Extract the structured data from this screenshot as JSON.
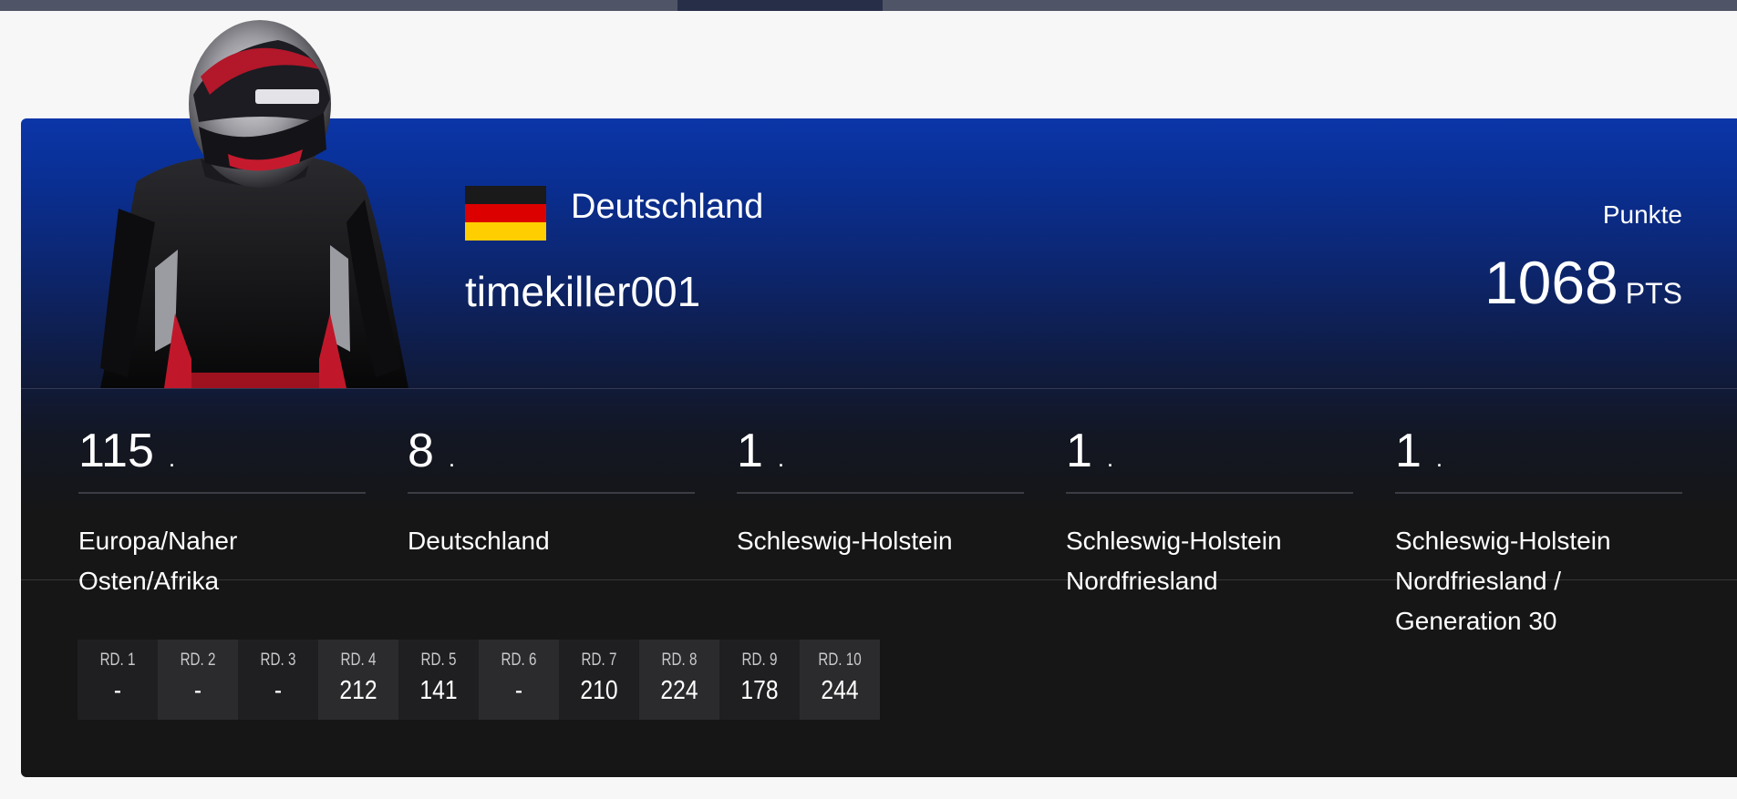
{
  "profile": {
    "country": "Deutschland",
    "username": "timekiller001",
    "points_label": "Punkte",
    "points_value": "1068",
    "points_unit": "PTS"
  },
  "flag_colors": [
    "#1a1a1a",
    "#dd0000",
    "#ffce00"
  ],
  "rankings": [
    {
      "rank": "115",
      "dot": ".",
      "region_lines": [
        "Europa/Naher",
        "Osten/Afrika"
      ]
    },
    {
      "rank": "8",
      "dot": ".",
      "region_lines": [
        "Deutschland"
      ]
    },
    {
      "rank": "1",
      "dot": ".",
      "region_lines": [
        "Schleswig-Holstein"
      ]
    },
    {
      "rank": "1",
      "dot": ".",
      "region_lines": [
        "Schleswig-Holstein",
        "Nordfriesland"
      ]
    },
    {
      "rank": "1",
      "dot": ".",
      "region_lines": [
        "Schleswig-Holstein",
        "Nordfriesland /",
        "Generation 30"
      ]
    }
  ],
  "rounds": [
    {
      "label": "RD. 1",
      "score": "-"
    },
    {
      "label": "RD. 2",
      "score": "-"
    },
    {
      "label": "RD. 3",
      "score": "-"
    },
    {
      "label": "RD. 4",
      "score": "212"
    },
    {
      "label": "RD. 5",
      "score": "141"
    },
    {
      "label": "RD. 6",
      "score": "-"
    },
    {
      "label": "RD. 7",
      "score": "210"
    },
    {
      "label": "RD. 8",
      "score": "224"
    },
    {
      "label": "RD. 9",
      "score": "178"
    },
    {
      "label": "RD. 10",
      "score": "244"
    }
  ],
  "icons": {
    "driver_avatar": "driver-avatar-icon",
    "flag": "flag-germany-icon"
  }
}
